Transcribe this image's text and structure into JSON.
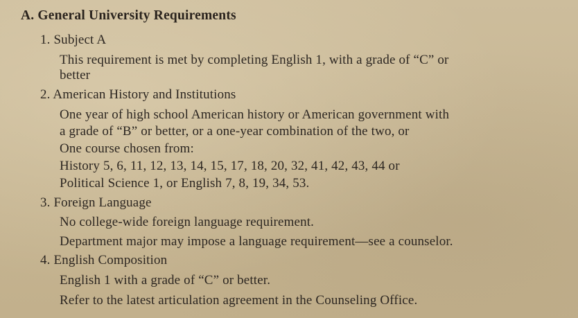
{
  "section": {
    "heading": "A. General University Requirements",
    "items": [
      {
        "title": "1. Subject A",
        "lines": [
          "This requirement is met by completing English 1, with a grade of “C” or",
          "better"
        ]
      },
      {
        "title": "2. American History and Institutions",
        "lines": [
          "One year of high school American history or American government with",
          "a grade of “B” or better, or a one-year combination of the two, or",
          "One course chosen from:",
          "History 5, 6, 11, 12, 13, 14, 15, 17, 18, 20, 32, 41, 42, 43, 44 or",
          "Political Science 1, or English 7, 8, 19, 34, 53."
        ]
      },
      {
        "title": "3. Foreign Language",
        "lines": [
          "No college-wide foreign language requirement.",
          "Department major may impose a language requirement—see a counselor."
        ]
      },
      {
        "title": "4. English Composition",
        "lines": [
          "English 1 with a grade of “C” or better.",
          "Refer to the latest articulation agreement in the Counseling Office."
        ]
      }
    ]
  }
}
